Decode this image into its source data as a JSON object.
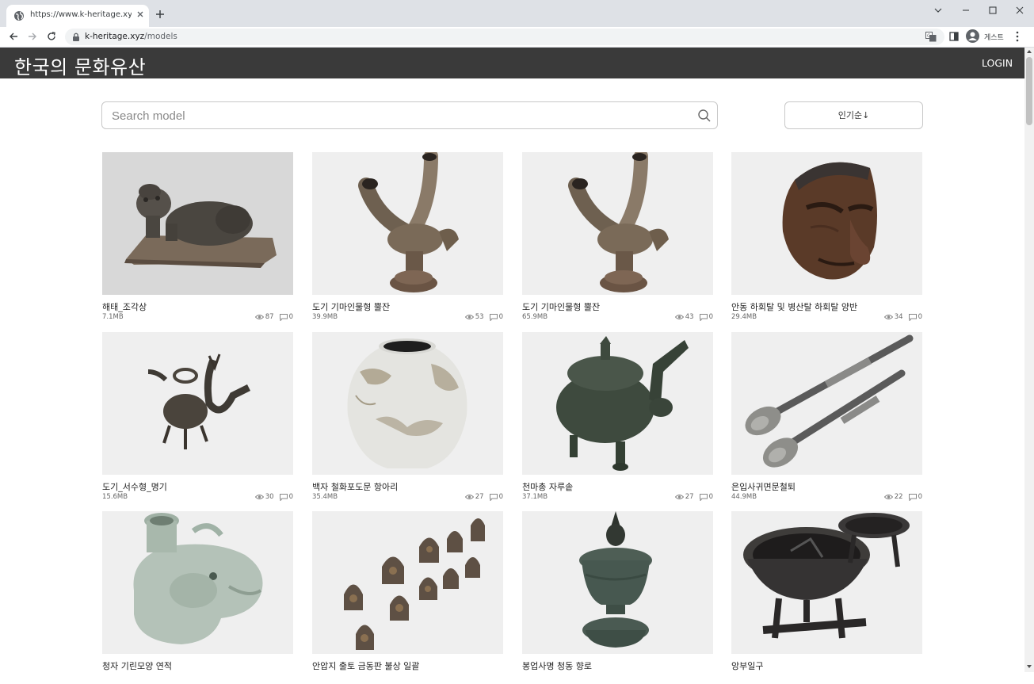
{
  "browser": {
    "tab_title": "https://www.k-heritage.xyz/models",
    "url_domain": "k-heritage.xyz",
    "url_path": "/models",
    "profile_name": "게스트"
  },
  "header": {
    "site_title": "한국의 문화유산",
    "login_label": "LOGIN"
  },
  "search": {
    "placeholder": "Search model"
  },
  "sort": {
    "label": "인기순↓"
  },
  "models": [
    {
      "title": "해태_조각상",
      "size": "7.1MB",
      "views": "87",
      "comments": "0",
      "thumb_icon": "stone-haetae-statue"
    },
    {
      "title": "도기 기마인물형 뿔잔",
      "size": "39.9MB",
      "views": "53",
      "comments": "0",
      "thumb_icon": "horse-rider-horn-cup"
    },
    {
      "title": "도기 기마인물형 뿔잔",
      "size": "65.9MB",
      "views": "43",
      "comments": "0",
      "thumb_icon": "horse-rider-horn-cup"
    },
    {
      "title": "안동 하회탈 및 병산탈 하회탈 양반",
      "size": "29.4MB",
      "views": "34",
      "comments": "0",
      "thumb_icon": "wooden-mask"
    },
    {
      "title": "도기_서수형_명기",
      "size": "15.6MB",
      "views": "30",
      "comments": "0",
      "thumb_icon": "dragon-vessel"
    },
    {
      "title": "백자 철화포도문 항아리",
      "size": "35.4MB",
      "views": "27",
      "comments": "0",
      "thumb_icon": "white-porcelain-jar"
    },
    {
      "title": "천마총 자루솥",
      "size": "37.1MB",
      "views": "27",
      "comments": "0",
      "thumb_icon": "bronze-kettle"
    },
    {
      "title": "은입사귀면문철퇴",
      "size": "44.9MB",
      "views": "22",
      "comments": "0",
      "thumb_icon": "iron-maces"
    },
    {
      "title": "청자 기린모양 연적",
      "thumb_icon": "celadon-water-dropper"
    },
    {
      "title": "안압지 출토 금동판 불상 일괄",
      "thumb_icon": "gilt-bronze-buddha-plaques"
    },
    {
      "title": "봉업사명 청동 향로",
      "thumb_icon": "bronze-incense-burner"
    },
    {
      "title": "앙부일구",
      "thumb_icon": "sundial-bowl"
    }
  ]
}
